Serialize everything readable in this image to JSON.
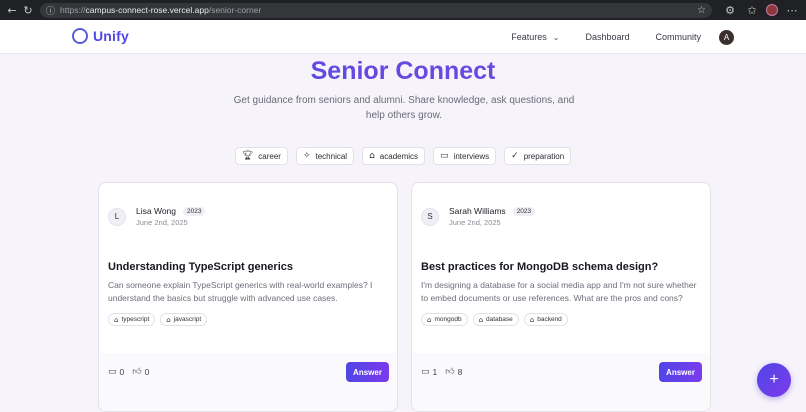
{
  "browser": {
    "url_scheme": "https://",
    "url_host": "campus-connect-rose.vercel.app",
    "url_path": "/senior-corner"
  },
  "nav": {
    "logo": "Unify",
    "features": "Features",
    "dashboard": "Dashboard",
    "community": "Community",
    "avatar": "A"
  },
  "hero": {
    "title": "Senior Connect",
    "subtitle": "Get guidance from seniors and alumni. Share knowledge, ask questions, and help others grow."
  },
  "categories": [
    {
      "label": "career",
      "icon": "trophy-icon"
    },
    {
      "label": "technical",
      "icon": "sparkles-icon"
    },
    {
      "label": "academics",
      "icon": "graduation-cap-icon"
    },
    {
      "label": "interviews",
      "icon": "message-square-icon"
    },
    {
      "label": "preparation",
      "icon": "check-circle-icon"
    }
  ],
  "posts": [
    {
      "initial": "L",
      "author": "Lisa Wong",
      "year": "2023",
      "date": "June 2nd, 2025",
      "title": "Understanding TypeScript generics",
      "body": "Can someone explain TypeScript generics with real-world examples? I understand the basics but struggle with advanced use cases.",
      "tags": [
        "typescript",
        "javascript"
      ],
      "answers": "0",
      "likes": "0",
      "button": "Answer"
    },
    {
      "initial": "S",
      "author": "Sarah Williams",
      "year": "2023",
      "date": "June 2nd, 2025",
      "title": "Best practices for MongoDB schema design?",
      "body": "I'm designing a database for a social media app and I'm not sure whether to embed documents or use references. What are the pros and cons?",
      "tags": [
        "mongodb",
        "database",
        "backend"
      ],
      "answers": "1",
      "likes": "8",
      "button": "Answer"
    }
  ],
  "fab": "+",
  "colors": {
    "accent": "#4f46e5",
    "accent_end": "#7c3aed",
    "background": "#f6f3fb"
  }
}
